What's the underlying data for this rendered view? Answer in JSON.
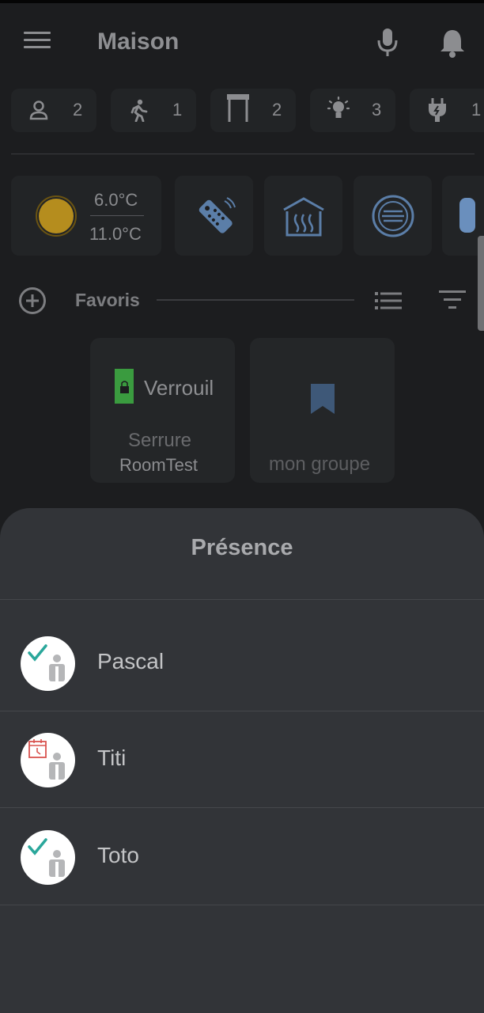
{
  "header": {
    "title": "Maison",
    "menu_icon": "hamburger-menu-icon",
    "mic_icon": "microphone-icon",
    "notif_icon": "bell-icon"
  },
  "chips": [
    {
      "icon": "person-icon",
      "count": "2"
    },
    {
      "icon": "walking-person-icon",
      "count": "1"
    },
    {
      "icon": "shutter-icon",
      "count": "2"
    },
    {
      "icon": "light-bulb-icon",
      "count": "3"
    },
    {
      "icon": "power-plug-icon",
      "count": "1"
    }
  ],
  "weather": {
    "current_temp": "6.0°C",
    "max_temp": "11.0°C",
    "icon": "sun-icon"
  },
  "widgets": [
    {
      "icon": "remote-control-icon"
    },
    {
      "icon": "heating-icon"
    },
    {
      "icon": "fan-icon"
    }
  ],
  "favorites_section": {
    "label": "Favoris",
    "add_icon": "add-circle-icon",
    "list_icon": "list-view-icon",
    "filter_icon": "filter-icon"
  },
  "favorites": [
    {
      "state": "Verrouil",
      "name": "Serrure",
      "room": "RoomTest",
      "icon": "lock-icon"
    },
    {
      "name": "mon groupe",
      "icon": "bookmark-icon"
    }
  ],
  "presence_sheet": {
    "title": "Présence",
    "persons": [
      {
        "name": "Pascal",
        "status": "present",
        "status_icon": "check-icon"
      },
      {
        "name": "Titi",
        "status": "absent",
        "status_icon": "absent-calendar-icon"
      },
      {
        "name": "Toto",
        "status": "present",
        "status_icon": "check-icon"
      }
    ]
  },
  "colors": {
    "background": "#1c1d1f",
    "tile": "#222426",
    "sheet": "#323438",
    "present_check": "#2aa79b",
    "absent": "#d9534f",
    "lock_green": "#3a9b3f",
    "sun_gold": "#b58d1e"
  }
}
